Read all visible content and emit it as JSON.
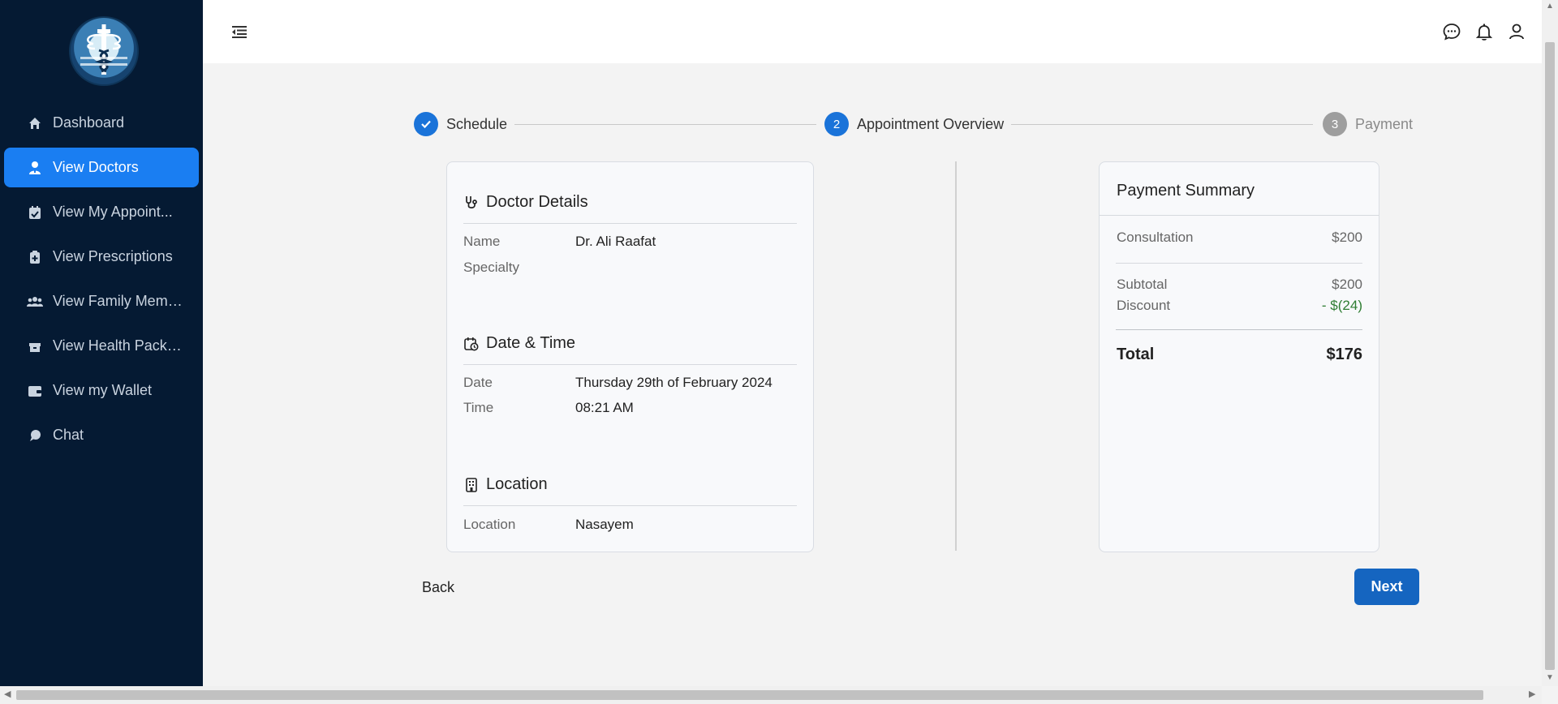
{
  "sidebar": {
    "logo_name": "caduceus-logo",
    "items": [
      {
        "label": "Dashboard",
        "icon": "home-icon",
        "active": false
      },
      {
        "label": "View Doctors",
        "icon": "doctor-icon",
        "active": true
      },
      {
        "label": "View My Appoint...",
        "icon": "calendar-check-icon",
        "active": false
      },
      {
        "label": "View Prescriptions",
        "icon": "prescription-icon",
        "active": false
      },
      {
        "label": "View Family Memb...",
        "icon": "users-icon",
        "active": false
      },
      {
        "label": "View Health Packa...",
        "icon": "box-icon",
        "active": false
      },
      {
        "label": "View my Wallet",
        "icon": "wallet-icon",
        "active": false
      },
      {
        "label": "Chat",
        "icon": "chat-bubble-icon",
        "active": false
      }
    ]
  },
  "topbar": {
    "icons": [
      "menu-toggle-icon",
      "message-icon",
      "bell-icon",
      "user-icon"
    ]
  },
  "stepper": {
    "steps": [
      {
        "number": "1",
        "label": "Schedule",
        "state": "done"
      },
      {
        "number": "2",
        "label": "Appointment Overview",
        "state": "active"
      },
      {
        "number": "3",
        "label": "Payment",
        "state": "pending"
      }
    ]
  },
  "details": {
    "doctor": {
      "title": "Doctor Details",
      "name_label": "Name",
      "name_value": "Dr. Ali Raafat",
      "specialty_label": "Specialty",
      "specialty_value": ""
    },
    "datetime": {
      "title": "Date & Time",
      "date_label": "Date",
      "date_value": "Thursday 29th of February 2024",
      "time_label": "Time",
      "time_value": "08:21 AM"
    },
    "location": {
      "title": "Location",
      "location_label": "Location",
      "location_value": "Nasayem"
    }
  },
  "summary": {
    "title": "Payment Summary",
    "consultation_label": "Consultation",
    "consultation_value": "$200",
    "subtotal_label": "Subtotal",
    "subtotal_value": "$200",
    "discount_label": "Discount",
    "discount_value": "- $(24)",
    "total_label": "Total",
    "total_value": "$176"
  },
  "buttons": {
    "back": "Back",
    "next": "Next"
  },
  "colors": {
    "sidebar_bg": "#051a33",
    "active_nav": "#1a7ef2",
    "primary": "#1565c0",
    "step_active": "#1a73d9",
    "discount": "#2e7d32"
  }
}
